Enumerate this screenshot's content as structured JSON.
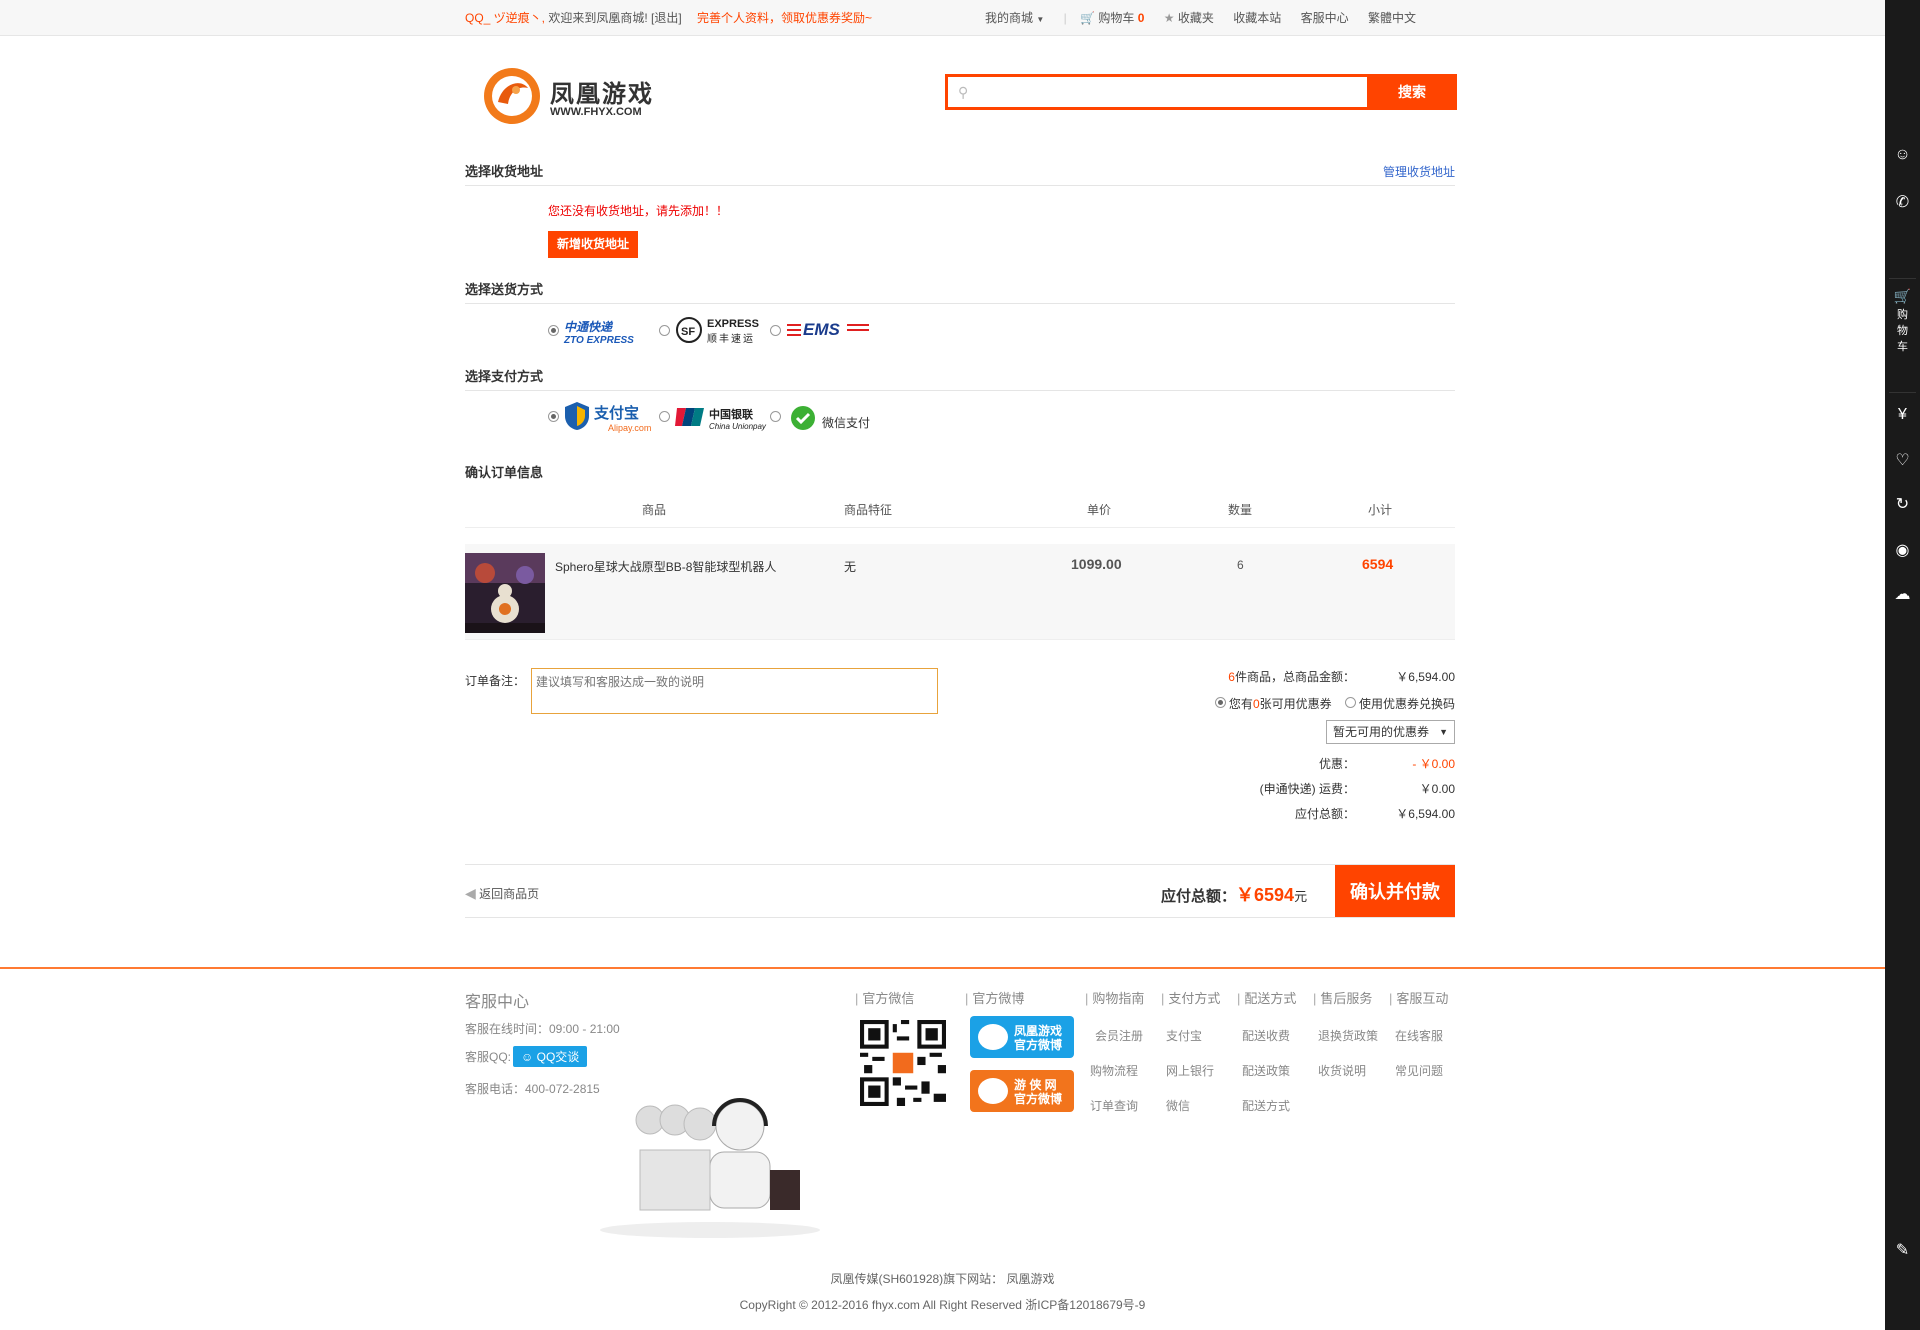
{
  "topbar": {
    "user": "QQ_ ヅ逆痕丶,",
    "welcome": "欢迎来到凤凰商城! [退出]",
    "promo": "完善个人资料，领取优惠券奖励~",
    "my_mall": "我的商城",
    "cart": "购物车",
    "cart_count": "0",
    "favorites": "收藏夹",
    "bookmark": "收藏本站",
    "service": "客服中心",
    "lang": "繁體中文"
  },
  "logo": {
    "name": "凤凰游戏",
    "url": "WWW.FHYX.COM"
  },
  "search": {
    "placeholder": "",
    "button": "搜索"
  },
  "address": {
    "title": "选择收货地址",
    "manage": "管理收货地址",
    "empty_msg": "您还没有收货地址，请先添加！！",
    "add_button": "新增收货地址"
  },
  "shipping": {
    "title": "选择送货方式",
    "options": [
      {
        "name": "中通快递",
        "sub": "ZTO EXPRESS",
        "selected": true
      },
      {
        "name": "EXPRESS",
        "sub": "顺丰速运",
        "selected": false
      },
      {
        "name": "EMS",
        "sub": "",
        "selected": false
      }
    ]
  },
  "payment": {
    "title": "选择支付方式",
    "options": [
      {
        "name": "支付宝",
        "sub": "Alipay.com",
        "selected": true
      },
      {
        "name": "中国银联",
        "sub": "China Unionpay",
        "selected": false
      },
      {
        "name": "微信支付",
        "sub": "",
        "selected": false
      }
    ]
  },
  "order": {
    "title": "确认订单信息",
    "columns": [
      "商品",
      "商品特征",
      "单价",
      "数量",
      "小计"
    ],
    "items": [
      {
        "name": "Sphero星球大战原型BB-8智能球型机器人",
        "feature": "无",
        "price": "1099.00",
        "qty": "6",
        "subtotal": "6594"
      }
    ]
  },
  "note": {
    "label": "订单备注：",
    "placeholder": "建议填写和客服达成一致的说明"
  },
  "summary": {
    "count": "6",
    "count_text": "件商品，总商品金额：",
    "goods_total": "￥6,594.00",
    "coupon_have_pre": "您有",
    "coupon_count": "0",
    "coupon_have_post": "张可用优惠券",
    "coupon_code": "使用优惠券兑换码",
    "coupon_select": "暂无可用的优惠券",
    "discount_lbl": "优惠：",
    "discount": "- ￥0.00",
    "shipping_lbl": "(申通快递) 运费：",
    "shipping": "￥0.00",
    "payable_lbl": "应付总额：",
    "payable": "￥6,594.00"
  },
  "bottom": {
    "back": "返回商品页",
    "total_lbl": "应付总额：",
    "total": "￥6594",
    "unit": "元",
    "confirm": "确认并付款"
  },
  "footer": {
    "service_title": "客服中心",
    "hours": "客服在线时间：09:00 - 21:00",
    "qq_lbl": "客服QQ:",
    "qq_btn": "QQ交谈",
    "phone": "客服电话：400-072-2815",
    "wechat": "官方微信",
    "weibo": "官方微博",
    "weibo1": [
      "凤凰游戏",
      "官方微博"
    ],
    "weibo2": [
      "游 侠 网",
      "官方微博"
    ],
    "cols": [
      {
        "title": "购物指南",
        "links": [
          "会员注册",
          "购物流程",
          "订单查询"
        ]
      },
      {
        "title": "支付方式",
        "links": [
          "支付宝",
          "网上银行",
          "微信"
        ]
      },
      {
        "title": "配送方式",
        "links": [
          "配送收费",
          "配送政策",
          "配送方式"
        ]
      },
      {
        "title": "售后服务",
        "links": [
          "退换货政策",
          "收货说明"
        ]
      },
      {
        "title": "客服互动",
        "links": [
          "在线客服",
          "常见问题"
        ]
      }
    ],
    "company": "凤凰传媒(SH601928)旗下网站： 凤凰游戏",
    "copyright": "CopyRight © 2012-2016 fhyx.com All Right Reserved 浙ICP备12018679号-9"
  },
  "sidebar": {
    "cart_label": "购物车"
  },
  "colors": {
    "accent": "#ff4400",
    "link": "#3366cc"
  }
}
